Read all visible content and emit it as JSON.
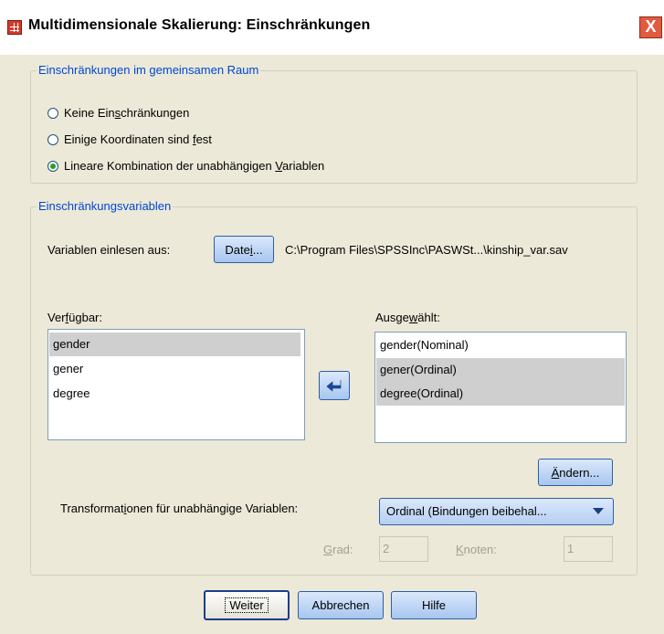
{
  "window": {
    "title": "Multidimensionale Skalierung: Einschränkungen",
    "close_label": "X"
  },
  "space_restrictions": {
    "title": "Einschränkungen im gemeinsamen Raum",
    "options": [
      {
        "label_pre": "Keine Ein",
        "label_ul": "s",
        "label_post": "chränkungen",
        "checked": false
      },
      {
        "label_pre": "Einige Koordinaten sind ",
        "label_ul": "f",
        "label_post": "est",
        "checked": false
      },
      {
        "label_pre": "Lineare Kombination der unabhängigen ",
        "label_ul": "V",
        "label_post": "ariablen",
        "checked": true
      }
    ]
  },
  "restriction_variables": {
    "title": "Einschränkungsvariablen",
    "read_from_label": "Variablen einlesen aus:",
    "file_button_pre": "Date",
    "file_button_ul": "i",
    "file_button_post": "...",
    "file_path": "C:\\Program Files\\SPSSInc\\PASWSt...\\kinship_var.sav",
    "available": {
      "label_pre": "Ver",
      "label_ul": "f",
      "label_post": "ügbar:",
      "items": [
        "gender",
        "gener",
        "degree"
      ],
      "selected_index": 0
    },
    "selected": {
      "label_pre": "Ausge",
      "label_ul": "w",
      "label_post": "ählt:",
      "items": [
        "gender(Nominal)",
        "gener(Ordinal)",
        "degree(Ordinal)"
      ],
      "highlighted": [
        1,
        2
      ]
    },
    "change_button_ul": "Ä",
    "change_button_post": "ndern...",
    "transform_label_pre": "Transformat",
    "transform_label_ul": "i",
    "transform_label_post": "onen für unabhängige Variablen:",
    "transform_value": "Ordinal (Bindungen beibehal...",
    "degree_label_ul": "G",
    "degree_label_post": "rad:",
    "degree_value": "2",
    "knots_label_ul": "K",
    "knots_label_post": "noten:",
    "knots_value": "1"
  },
  "footer": {
    "continue_label": "Weiter",
    "cancel_label": "Abbrechen",
    "help_label": "Hilfe"
  }
}
